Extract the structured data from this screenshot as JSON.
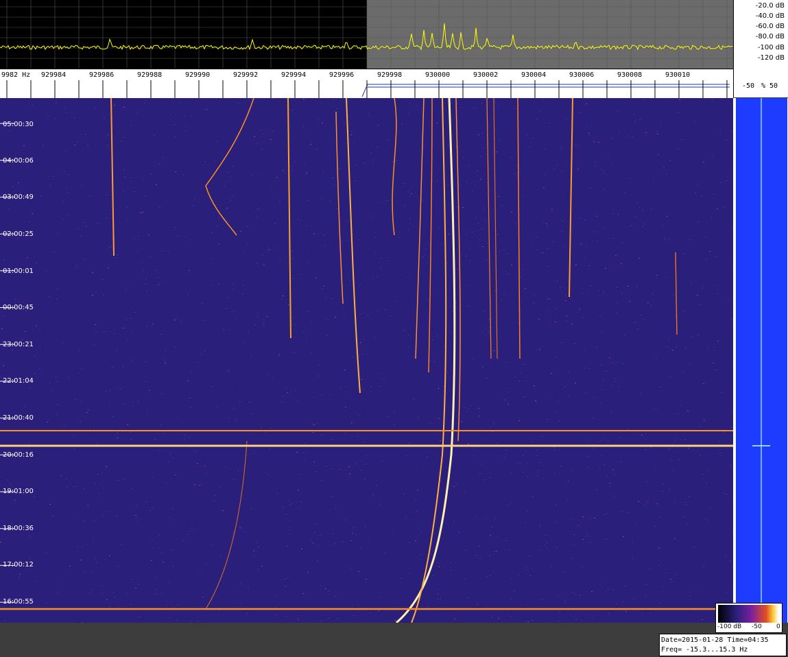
{
  "spectrum": {
    "db_labels": [
      "-20.0 dB",
      "-40.0 dB",
      "-60.0 dB",
      "-80.0 dB",
      "-100 dB",
      "-120 dB"
    ]
  },
  "freq_axis": {
    "unit": "Hz",
    "first": "9982",
    "labels": [
      "929984",
      "929986",
      "929988",
      "929990",
      "929992",
      "929994",
      "929996",
      "929998",
      "930000",
      "930002",
      "930004",
      "930006",
      "930008",
      "930010"
    ]
  },
  "offset_header": {
    "left": "-50",
    "mid": "%",
    "right": "50"
  },
  "waterfall": {
    "time_labels": [
      "05:00:30",
      "04:00:06",
      "03:00:49",
      "02:00:25",
      "01:00:01",
      "00:00:45",
      "23:00:21",
      "22:01:04",
      "21:00:40",
      "20:00:16",
      "19:01:00",
      "18:00:36",
      "17:00:12",
      "16:00:55"
    ]
  },
  "colorbar": {
    "min": "-100 dB",
    "mid": "-50",
    "max": "0"
  },
  "info": {
    "line1": "Date=2015-01-28 Time=04:35",
    "line2": "Freq= -15.3...15.3 Hz"
  },
  "colors": {
    "trace": "#ffff00",
    "waterfall_bg": "#2a1f7a",
    "signal": "#ff8c1a",
    "offset_bg": "#1e3cff"
  }
}
